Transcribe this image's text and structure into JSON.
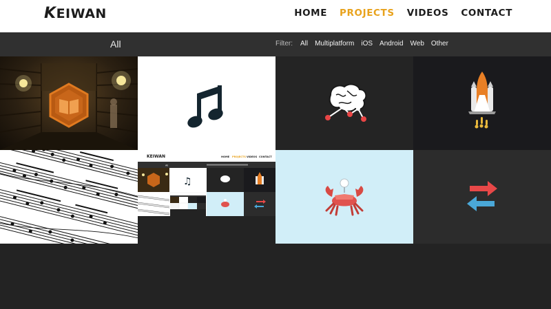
{
  "header": {
    "logo": "EIWAN",
    "logo_k": "K",
    "nav": {
      "home": "HOME",
      "projects": "PROJECTS",
      "videos": "VIDEOS",
      "contact": "CONTACT"
    },
    "active_color": "#e8a21c"
  },
  "filterbar": {
    "category_title": "All",
    "filter_label": "Filter:",
    "filters": [
      "All",
      "Multiplatform",
      "iOS",
      "Android",
      "Web",
      "Other"
    ]
  },
  "thumbnail": {
    "logo": "KEIWAN",
    "nav": [
      "HOME",
      "PROJECTS",
      "VIDEOS",
      "CONTACT"
    ],
    "category_title": "All"
  },
  "colors": {
    "header_bg": "#ffffff",
    "bar_bg": "#303030",
    "page_bg": "#232323",
    "accent": "#e8a21c"
  }
}
